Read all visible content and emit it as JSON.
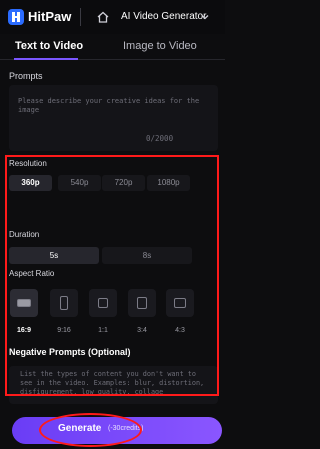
{
  "header": {
    "brand": "HitPaw",
    "product": "AI Video Generator"
  },
  "tabs": [
    {
      "label": "Text to Video",
      "active": true
    },
    {
      "label": "Image to Video",
      "active": false
    }
  ],
  "prompt": {
    "label": "Prompts",
    "placeholder": "Please describe your creative ideas for the image",
    "counter": "0/2000"
  },
  "resolution": {
    "label": "Resolution",
    "options": [
      "360p",
      "540p",
      "720p",
      "1080p"
    ],
    "selected": "360p"
  },
  "duration": {
    "label": "Duration",
    "options": [
      "5s",
      "8s"
    ],
    "selected": "5s"
  },
  "aspect_ratio": {
    "label": "Aspect Ratio",
    "options": [
      "16:9",
      "9:16",
      "1:1",
      "3:4",
      "4:3"
    ],
    "selected": "16:9"
  },
  "negative_prompts": {
    "label": "Negative Prompts (Optional)",
    "placeholder": "List the types of content you don't want to see in the video. Examples: blur, distortion, disfigurement, low quality, collage"
  },
  "generate": {
    "label": "Generate",
    "credits": "(-30credits)"
  },
  "colors": {
    "accent": "#7b57ff",
    "highlight_annotation": "#ff1a1a"
  }
}
